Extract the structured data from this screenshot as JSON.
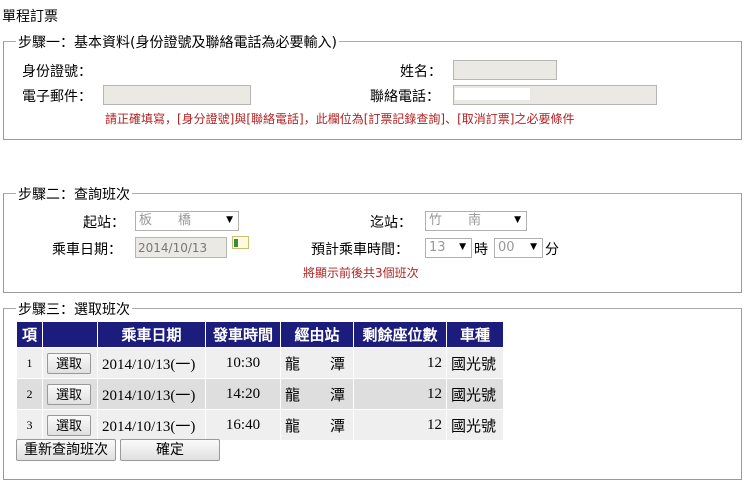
{
  "title": "單程訂票",
  "step1": {
    "legend": "步驟一：基本資料(身份證號及聯絡電話為必要輸入)",
    "id_label": "身份證號：",
    "name_label": "姓名：",
    "email_label": "電子郵件：",
    "phone_label": "聯絡電話：",
    "note": "請正確填寫，[身分證號]與[聯絡電話]，此欄位為[訂票記錄查詢]、[取消訂票]之必要條件"
  },
  "step2": {
    "legend": "步驟二：查詢班次",
    "from_label": "起站：",
    "from_value": "板　　橋",
    "to_label": "迄站：",
    "to_value": "竹　　南",
    "date_label": "乘車日期：",
    "date_value": "2014/10/13",
    "time_label": "預計乘車時間：",
    "hour_value": "13",
    "hour_unit": "時",
    "minute_value": "00",
    "minute_unit": "分",
    "note": "將顯示前後共3個班次"
  },
  "step3": {
    "legend": "步驟三：選取班次",
    "headers": [
      "項",
      "",
      "乘車日期",
      "發車時間",
      "經由站",
      "剩餘座位數",
      "車種"
    ],
    "rows": [
      {
        "no": "1",
        "select": "選取",
        "date": "2014/10/13(一)",
        "time": "10:30",
        "via": "龍　　潭",
        "seats": "12",
        "type": "國光號"
      },
      {
        "no": "2",
        "select": "選取",
        "date": "2014/10/13(一)",
        "time": "14:20",
        "via": "龍　　潭",
        "seats": "12",
        "type": "國光號"
      },
      {
        "no": "3",
        "select": "選取",
        "date": "2014/10/13(一)",
        "time": "16:40",
        "via": "龍　　潭",
        "seats": "12",
        "type": "國光號"
      }
    ],
    "requery": "重新查詢班次",
    "confirm": "確定"
  },
  "colors": {
    "header_bg": "#1c1c7c",
    "note": "#b22222"
  }
}
